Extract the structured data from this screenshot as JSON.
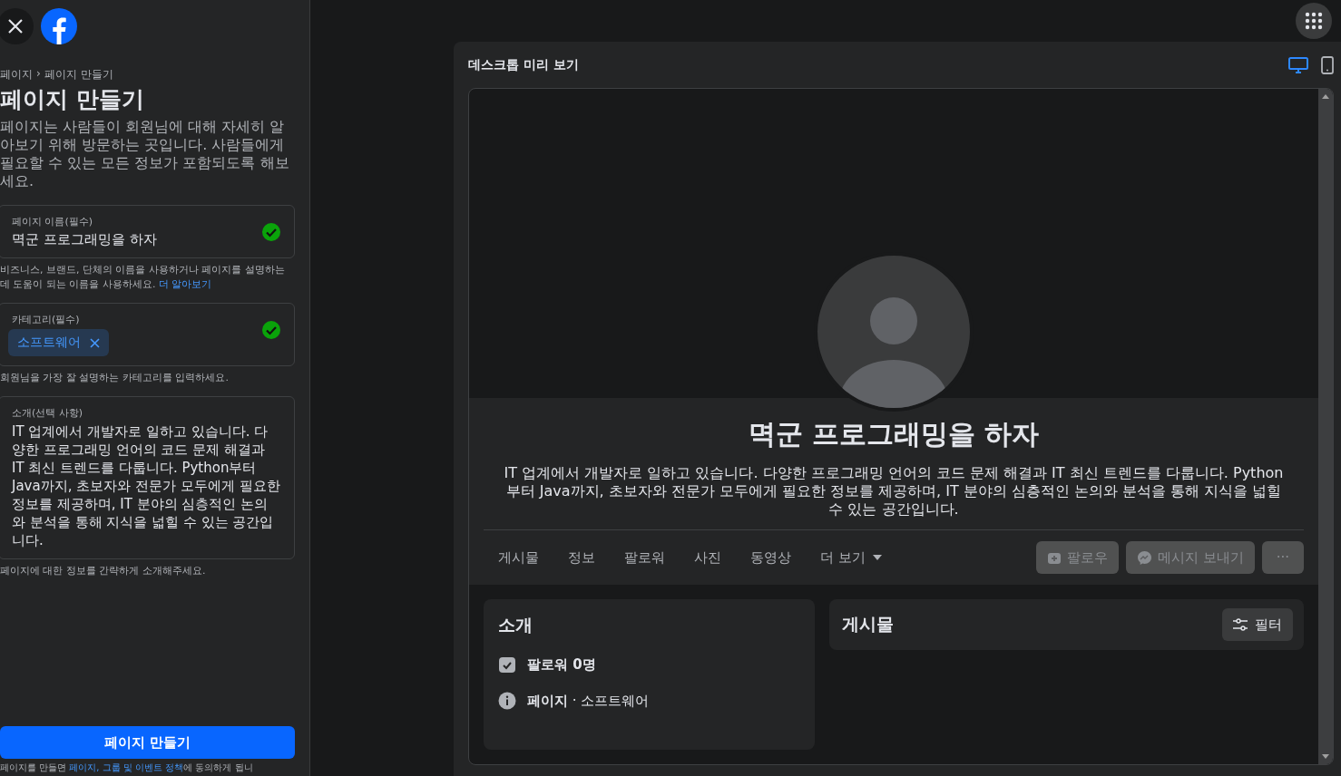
{
  "breadcrumb": {
    "items": [
      "페이지",
      "페이지 만들기"
    ],
    "separator": "›"
  },
  "title": "페이지 만들기",
  "intro": "페이지는 사람들이 회원님에 대해 자세히 알아보기 위해 방문하는 곳입니다. 사람들에게 필요할 수 있는 모든 정보가 포함되도록 해보세요.",
  "name_field": {
    "label": "페이지 이름(필수)",
    "value": "멱군 프로그래밍을 하자",
    "valid": true
  },
  "name_help": {
    "text": "비즈니스, 브랜드, 단체의 이름을 사용하거나 페이지를 설명하는 데 도움이 되는 이름을 사용하세요.",
    "link": "더 알아보기"
  },
  "category_field": {
    "label": "카테고리(필수)",
    "chips": [
      "소프트웨어"
    ],
    "valid": true
  },
  "category_help": "회원님을 가장 잘 설명하는 카테고리를 입력하세요.",
  "bio_field": {
    "label": "소개(선택 사항)",
    "value": "IT 업계에서 개발자로 일하고 있습니다. 다양한 프로그래밍 언어의 코드 문제 해결과 IT 최신 트렌드를 다룹니다. Python부터 Java까지, 초보자와 전문가 모두에게 필요한 정보를 제공하며, IT 분야의 심층적인 논의와 분석을 통해 지식을 넓힐 수 있는 공간입니다."
  },
  "bio_help": "페이지에 대한 정보를 간략하게 소개해주세요.",
  "create_button": "페이지 만들기",
  "terms": {
    "before": "페이지를 만들면 ",
    "link": "페이지, 그룹 및 이벤트 정책",
    "after": "에 동의하게 됩니"
  },
  "preview": {
    "title": "데스크톱 미리 보기",
    "modes": [
      {
        "kind": "desktop",
        "selected": true
      },
      {
        "kind": "mobile",
        "selected": false
      }
    ],
    "page_name": "멱군 프로그래밍을 하자",
    "bio": "IT 업계에서 개발자로 일하고 있습니다. 다양한 프로그래밍 언어의 코드 문제 해결과 IT 최신 트렌드를 다룹니다. Python부터 Java까지, 초보자와 전문가 모두에게 필요한 정보를 제공하며, IT 분야의 심층적인 논의와 분석을 통해 지식을 넓힐 수 있는 공간입니다.",
    "tabs": [
      {
        "label": "게시물",
        "dropdown": false
      },
      {
        "label": "정보",
        "dropdown": false
      },
      {
        "label": "팔로워",
        "dropdown": false
      },
      {
        "label": "사진",
        "dropdown": false
      },
      {
        "label": "동영상",
        "dropdown": false
      },
      {
        "label": "더 보기",
        "dropdown": true
      }
    ],
    "actions": [
      {
        "kind": "follow",
        "label": "팔로우",
        "disabled": true
      },
      {
        "kind": "message",
        "label": "메시지 보내기",
        "disabled": true
      },
      {
        "kind": "more",
        "label": "···",
        "disabled": true
      }
    ],
    "intro_card": {
      "title": "소개",
      "items": [
        {
          "kind": "followers",
          "text": "**팔로워 0명**"
        },
        {
          "kind": "info",
          "text": "**페이지** · 소프트웨어"
        }
      ]
    },
    "posts_card": {
      "title": "게시물",
      "filter": "필터"
    }
  }
}
